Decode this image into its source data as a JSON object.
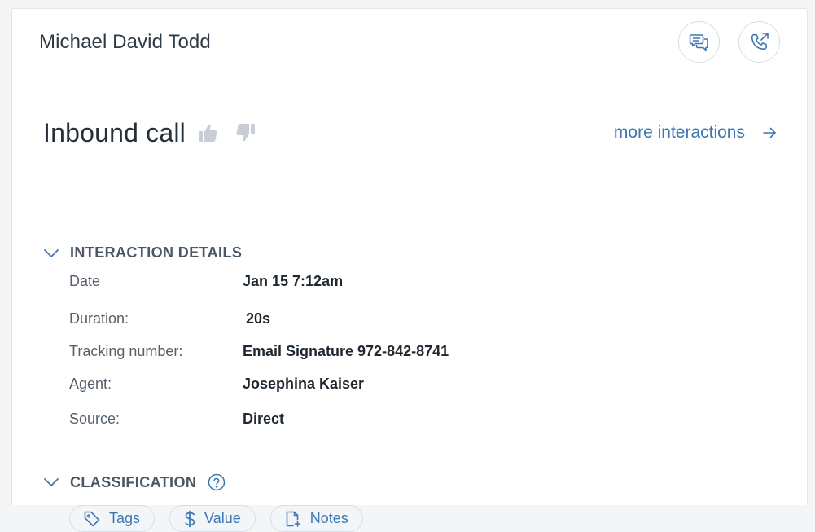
{
  "header": {
    "contact_name": "Michael David Todd",
    "actions": [
      {
        "icon": "chat-icon"
      },
      {
        "icon": "phone-outgoing-icon"
      }
    ]
  },
  "interaction": {
    "title": "Inbound call",
    "more_link": "more interactions",
    "thumbs": [
      "thumbs-up-icon",
      "thumbs-down-icon"
    ]
  },
  "details_section": {
    "label": "INTERACTION DETAILS",
    "rows": [
      {
        "label": "Date",
        "value": "Jan 15 7:12am"
      },
      {
        "label": "Duration:",
        "value": "20s"
      },
      {
        "label": "Tracking number:",
        "value": "Email Signature 972-842-8741"
      },
      {
        "label": "Agent:",
        "value": "Josephina Kaiser"
      },
      {
        "label": "Source:",
        "value": "Direct"
      }
    ]
  },
  "classification": {
    "label": "CLASSIFICATION",
    "pills": [
      {
        "label": "Tags",
        "icon": "tag-icon"
      },
      {
        "label": "Value",
        "icon": "dollar-icon"
      },
      {
        "label": "Notes",
        "icon": "note-add-icon"
      }
    ]
  },
  "colors": {
    "accent": "#3d76b0",
    "text": "#2f3a44",
    "border": "#e3e7eb"
  }
}
